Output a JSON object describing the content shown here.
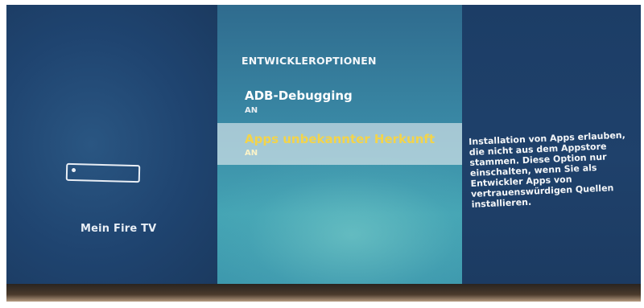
{
  "sidebar": {
    "device_icon": "fire-tv-device-icon",
    "device_label": "Mein Fire TV"
  },
  "menu": {
    "title": "ENTWICKLEROPTIONEN",
    "items": [
      {
        "label": "ADB-Debugging",
        "value": "AN",
        "selected": false
      },
      {
        "label": "Apps unbekannter Herkunft",
        "value": "AN",
        "selected": true
      }
    ]
  },
  "description": {
    "text": "Installation von Apps erlauben, die nicht aus dem Appstore stammen. Diese Option nur einschalten, wenn Sie als Entwickler Apps von vertrauenswürdigen Quellen installieren."
  },
  "colors": {
    "selected_label": "#f3d44a",
    "left_panel": "#1f4470",
    "middle_panel": "#3a8aa6",
    "right_panel": "#1f416b"
  }
}
